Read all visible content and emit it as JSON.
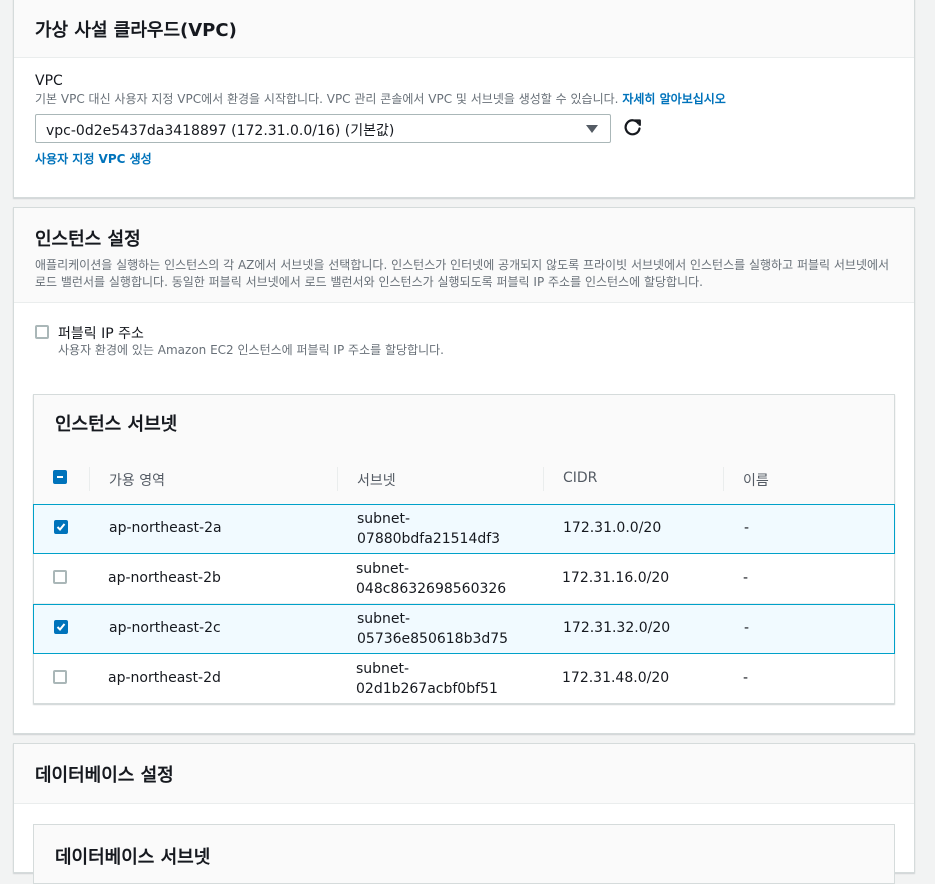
{
  "vpc_section": {
    "title": "가상 사설 클라우드(VPC)",
    "vpc_label": "VPC",
    "vpc_desc": "기본 VPC 대신 사용자 지정 VPC에서 환경을 시작합니다. VPC 관리 콘솔에서 VPC 및 서브넷을 생성할 수 있습니다.",
    "learn_more": "자세히 알아보십시오",
    "selected_vpc": "vpc-0d2e5437da3418897 (172.31.0.0/16) (기본값)",
    "create_vpc_link": "사용자 지정 VPC 생성"
  },
  "instance_section": {
    "title": "인스턴스 설정",
    "desc": "애플리케이션을 실행하는 인스턴스의 각 AZ에서 서브넷을 선택합니다. 인스턴스가 인터넷에 공개되지 않도록 프라이빗 서브넷에서 인스턴스를 실행하고 퍼블릭 서브넷에서 로드 밸런서를 실행합니다. 동일한 퍼블릭 서브넷에서 로드 밸런서와 인스턴스가 실행되도록 퍼블릭 IP 주소를 인스턴스에 할당합니다.",
    "public_ip_label": "퍼블릭 IP 주소",
    "public_ip_desc": "사용자 환경에 있는 Amazon EC2 인스턴스에 퍼블릭 IP 주소를 할당합니다.",
    "public_ip_checked": false,
    "subnet_table": {
      "title": "인스턴스 서브넷",
      "columns": [
        "가용 영역",
        "서브넷",
        "CIDR",
        "이름"
      ],
      "rows": [
        {
          "az": "ap-northeast-2a",
          "subnet_line1": "subnet-",
          "subnet_line2": "07880bdfa21514df3",
          "cidr": "172.31.0.0/20",
          "name": "-",
          "checked": true
        },
        {
          "az": "ap-northeast-2b",
          "subnet_line1": "subnet-",
          "subnet_line2": "048c8632698560326",
          "cidr": "172.31.16.0/20",
          "name": "-",
          "checked": false
        },
        {
          "az": "ap-northeast-2c",
          "subnet_line1": "subnet-",
          "subnet_line2": "05736e850618b3d75",
          "cidr": "172.31.32.0/20",
          "name": "-",
          "checked": true
        },
        {
          "az": "ap-northeast-2d",
          "subnet_line1": "subnet-",
          "subnet_line2": "02d1b267acbf0bf51",
          "cidr": "172.31.48.0/20",
          "name": "-",
          "checked": false
        }
      ]
    }
  },
  "database_section": {
    "title": "데이터베이스 설정",
    "subnet_title": "데이터베이스 서브넷"
  },
  "colors": {
    "accent": "#0073bb",
    "selected_row_bg": "#f1faff",
    "selected_row_border": "#00a1c9"
  }
}
